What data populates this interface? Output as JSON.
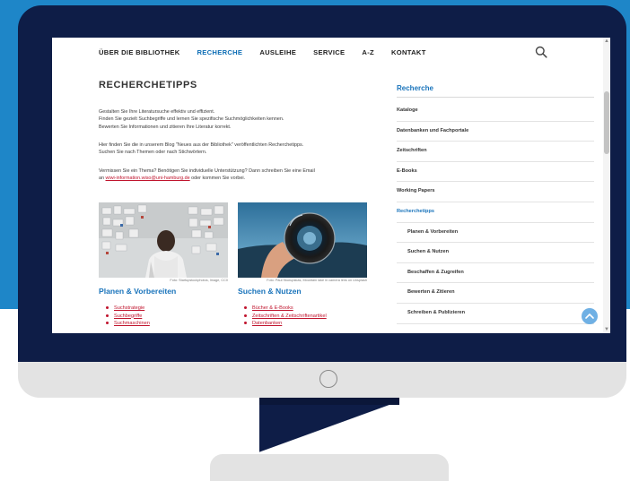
{
  "nav": {
    "items": [
      "ÜBER DIE BIBLIOTHEK",
      "RECHERCHE",
      "AUSLEIHE",
      "SERVICE",
      "A-Z",
      "KONTAKT"
    ],
    "active": "RECHERCHE"
  },
  "page": {
    "title": "RECHERCHETIPPS",
    "intro": [
      "Gestalten Sie Ihre Literatursuche effektiv und effizient.",
      "Finden Sie gezielt Suchbegriffe und lernen Sie spezifische Suchmöglichkeiten kennen.",
      "Bewerten Sie Informationen und zitieren Ihre Literatur korrekt."
    ],
    "blog": [
      "Hier finden Sie die in unserem Blog \"Neues aus der Bibliothek\" veröffentlichten Recherchetipps.",
      "Suchen Sie nach Themen oder nach Stichwörtern."
    ],
    "contact_line1": "Vermissen Sie ein Thema? Benötigen Sie individuelle Unterstützung? Dann schreiben Sie eine Email",
    "contact_prefix": "an ",
    "contact_email": "wiwi-information.wiso@uni-hamburg.de",
    "contact_suffix": " oder kommen Sie vorbei."
  },
  "cards": [
    {
      "title": "Planen & Vorbereiten",
      "caption": "Foto: Startupstockphotos, Image, CC0",
      "links": [
        "Suchstrategie",
        "Suchbegriffe",
        "Suchmaschinen"
      ]
    },
    {
      "title": "Suchen & Nutzen",
      "caption": "Foto: Paul Skorupskas, Mountain lake in camera lens on Unsplash",
      "links": [
        "Bücher & E-Books",
        "Zeitschriften & Zeitschriftenartikel",
        "Datenbanken"
      ]
    }
  ],
  "sidebar": {
    "heading": "Recherche",
    "items": [
      {
        "label": "Kataloge",
        "level": 0
      },
      {
        "label": "Datenbanken und Fachportale",
        "level": 0
      },
      {
        "label": "Zeitschriften",
        "level": 0
      },
      {
        "label": "E-Books",
        "level": 0
      },
      {
        "label": "Working Papers",
        "level": 0
      },
      {
        "label": "Recherchetipps",
        "level": 0,
        "active": true
      },
      {
        "label": "Planen & Vorbereiten",
        "level": 1
      },
      {
        "label": "Suchen & Nutzen",
        "level": 1
      },
      {
        "label": "Beschaffen & Zugreifen",
        "level": 1
      },
      {
        "label": "Bewerten & Zitieren",
        "level": 1
      },
      {
        "label": "Schreiben & Publizieren",
        "level": 1
      }
    ]
  },
  "icons": {
    "search": "search-icon",
    "to_top": "chevron-up-icon",
    "power": "power-button-icon"
  },
  "colors": {
    "background_blue": "#1e86c8",
    "monitor_navy": "#0e1d47",
    "accent_blue": "#1a74bb",
    "link_red": "#c0142d",
    "to_top_button": "#6fb0e4"
  }
}
